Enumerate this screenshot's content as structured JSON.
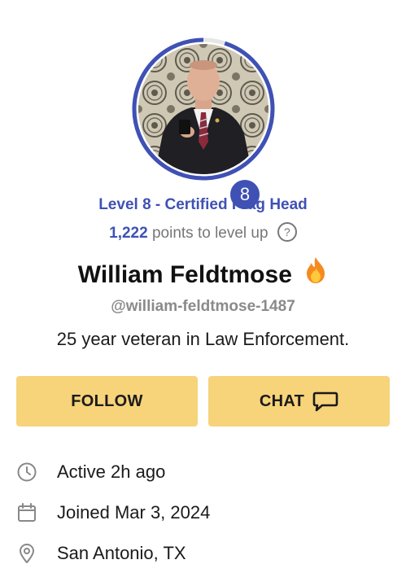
{
  "profile": {
    "level_badge": "8",
    "level_title": "Level 8 - Certified Frag Head",
    "points_value": "1,222",
    "points_suffix": "points to level up",
    "help_glyph": "?",
    "name": "William Feldtmose",
    "handle": "@william-feldtmose-1487",
    "bio": "25 year veteran in Law Enforcement.",
    "level_progress": 0.95
  },
  "actions": {
    "follow_label": "FOLLOW",
    "chat_label": "CHAT"
  },
  "info": {
    "active": "Active 2h ago",
    "joined": "Joined Mar 3, 2024",
    "location": "San Antonio, TX"
  },
  "colors": {
    "accent": "#3f51b5",
    "button": "#f7d37a",
    "muted": "#777777"
  },
  "icons": [
    "help-icon",
    "flame-icon",
    "chat-bubble-icon",
    "clock-icon",
    "calendar-icon",
    "location-pin-icon"
  ]
}
